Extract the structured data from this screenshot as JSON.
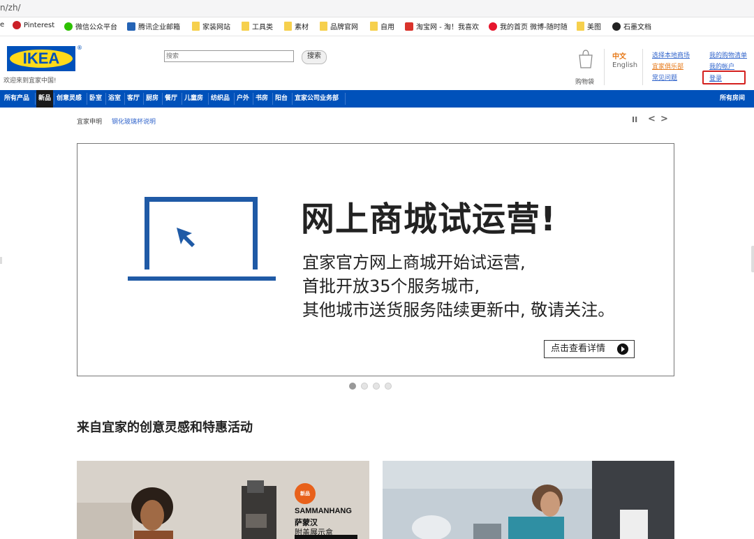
{
  "browser": {
    "address": "n/zh/",
    "bookmarks": [
      {
        "label": "e",
        "icon": "page-icon"
      },
      {
        "label": "Pinterest",
        "icon": "pinterest-icon"
      },
      {
        "label": "微信公众平台",
        "icon": "wechat-icon"
      },
      {
        "label": "腾讯企业邮箱",
        "icon": "mail-icon"
      },
      {
        "label": "家装网站",
        "icon": "folder-icon"
      },
      {
        "label": "工具类",
        "icon": "folder-icon"
      },
      {
        "label": "素材",
        "icon": "folder-icon"
      },
      {
        "label": "品牌官网",
        "icon": "folder-icon"
      },
      {
        "label": "自用",
        "icon": "folder-icon"
      },
      {
        "label": "淘宝网 - 淘！我喜欢",
        "icon": "taobao-icon"
      },
      {
        "label": "我的首页 微博-随时随",
        "icon": "weibo-icon"
      },
      {
        "label": "美图",
        "icon": "folder-icon"
      },
      {
        "label": "石墨文档",
        "icon": "shimo-icon"
      }
    ]
  },
  "header": {
    "logo_text": "IKEA",
    "registered": "®",
    "welcome": "欢迎来到宜家中国!",
    "search": {
      "placeholder": "搜索",
      "button": "搜索"
    },
    "cart_label": "购物袋",
    "lang_zh": "中文",
    "lang_en": "English",
    "links": {
      "choose_store": "选择本地商场",
      "family": "宜家俱乐部",
      "faq": "常见问题",
      "shopping_list": "我的购物清单",
      "my_account": "我的帐户",
      "login": "登录"
    }
  },
  "nav": {
    "items": [
      "所有产品",
      "新品",
      "创意灵感",
      "卧室",
      "浴室",
      "客厅",
      "厨房",
      "餐厅",
      "儿童房",
      "纺织品",
      "户外",
      "书房",
      "阳台",
      "宜家公司业务部"
    ],
    "active": "新品",
    "right": "所有房间"
  },
  "notice": {
    "label": "宜家申明",
    "link": "钢化玻璃杯说明"
  },
  "carousel_controls": {
    "pause": "II",
    "prev": "<",
    "next": ">"
  },
  "banner": {
    "title": "网上商城试运营!",
    "lines": [
      "宜家官方网上商城开始试运营,",
      "首批开放35个服务城市,",
      "其他城市送货服务陆续更新中, 敬请关注。"
    ],
    "cta": "点击查看详情"
  },
  "section_title": "来自宜家的创意灵感和特惠活动",
  "promo": {
    "badge": "新品",
    "name": "SAMMANHANG",
    "sub1": "萨蒙汉",
    "sub2": "附盖展示盒"
  },
  "colors": {
    "brand_blue": "#0051ba",
    "brand_yellow": "#ffda1a",
    "accent_orange": "#e67817",
    "highlight_red": "#d4201e"
  }
}
